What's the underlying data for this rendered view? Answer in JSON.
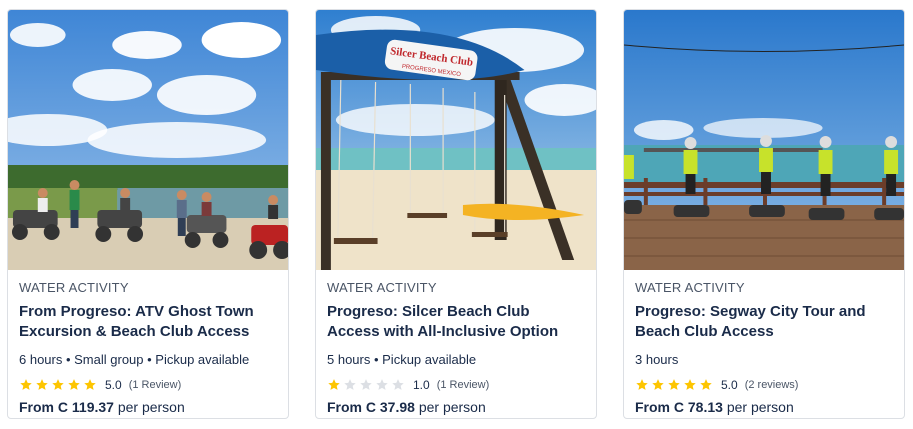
{
  "cards": [
    {
      "category": "WATER ACTIVITY",
      "title": "From Progreso: ATV Ghost Town Excursion & Beach Club Access",
      "meta": "6 hours • Small group • Pickup available",
      "rating_value": 5,
      "score": "5.0",
      "reviews": "(1 Review)",
      "price_from": "From C 119.37",
      "price_unit": "per person",
      "image": "atv-group-lagoon-photo"
    },
    {
      "category": "WATER ACTIVITY",
      "title": "Progreso: Silcer Beach Club Access with All-Inclusive Option",
      "meta": "5 hours • Pickup available",
      "rating_value": 1,
      "score": "1.0",
      "reviews": "(1 Review)",
      "price_from": "From C 37.98",
      "price_unit": "per person",
      "image": "beach-swing-sign-photo",
      "sign_text": "Silcer Beach Club",
      "sign_subtext": "PROGRESO MEXICO"
    },
    {
      "category": "WATER ACTIVITY",
      "title": "Progreso: Segway City Tour and Beach Club Access",
      "meta": "3 hours",
      "rating_value": 5,
      "score": "5.0",
      "reviews": "(2 reviews)",
      "price_from": "From C 78.13",
      "price_unit": "per person",
      "image": "segway-pier-photo"
    }
  ],
  "colors": {
    "star_filled": "#fdc500",
    "star_empty": "#dcdfe4",
    "text_primary": "#1a2b49",
    "text_secondary": "#4a5566"
  }
}
